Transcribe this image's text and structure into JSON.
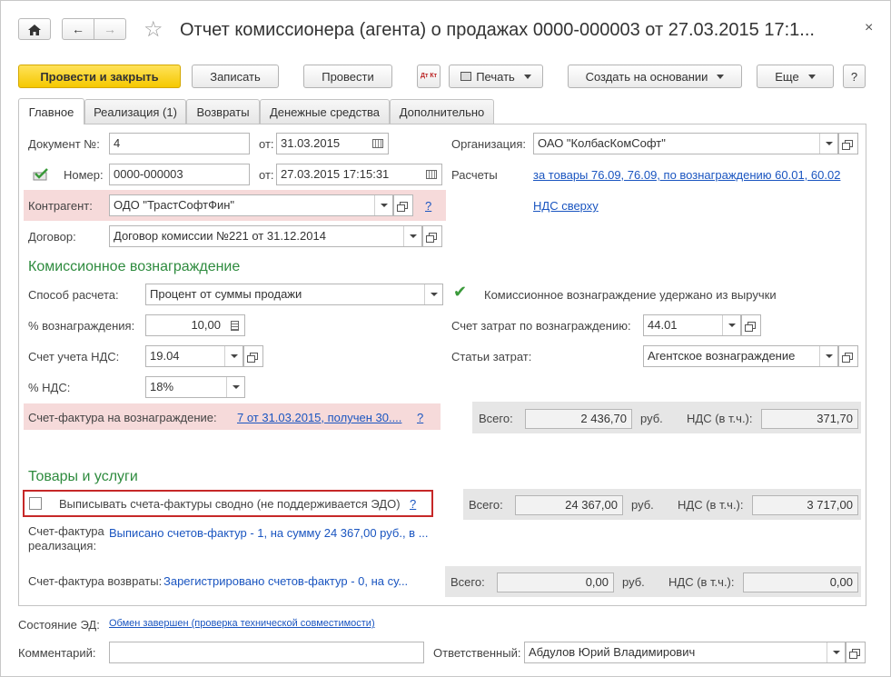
{
  "window": {
    "title": "Отчет комиссионера (агента) о продажах 0000-000003 от 27.03.2015 17:1...",
    "close": "×",
    "home": "⌂",
    "back": "←",
    "forward": "→",
    "star": "☆"
  },
  "toolbar": {
    "post_close": "Провести и закрыть",
    "save": "Записать",
    "post": "Провести",
    "dtkt": "Дт Кт",
    "print": "Печать",
    "create_based": "Создать на основании",
    "more": "Еще",
    "help": "?"
  },
  "tabs": [
    "Главное",
    "Реализация (1)",
    "Возвраты",
    "Денежные средства",
    "Дополнительно"
  ],
  "main": {
    "doc_no_label": "Документ №:",
    "doc_no": "4",
    "from_label": "от:",
    "doc_date": "31.03.2015",
    "number_label": "Номер:",
    "number": "0000-000003",
    "number_date": "27.03.2015 17:15:31",
    "org_label": "Организация:",
    "org": "ОАО \"КолбасКомСофт\"",
    "calc_label": "Расчеты",
    "calc_link": "за товары 76.09, 76.09, по вознаграждению 60.01, 60.02",
    "vat_top_link": "НДС сверху",
    "counterparty_label": "Контрагент:",
    "counterparty": "ОДО \"ТрастСофтФин\"",
    "question": "?",
    "contract_label": "Договор:",
    "contract": "Договор комиссии №221 от 31.12.2014"
  },
  "commission": {
    "section_title": "Комиссионное вознаграждение",
    "method_label": "Способ расчета:",
    "method": "Процент от суммы продажи",
    "retained_label": "Комиссионное вознаграждение удержано из выручки",
    "percent_label": "% вознаграждения:",
    "percent": "10,00",
    "cost_account_label": "Счет затрат по вознаграждению:",
    "cost_account": "44.01",
    "vat_account_label": "Счет учета НДС:",
    "vat_account": "19.04",
    "cost_items_label": "Статьи затрат:",
    "cost_items": "Агентское вознаграждение",
    "vat_rate_label": "% НДС:",
    "vat_rate": "18%",
    "invoice_label": "Счет-фактура на вознаграждение:",
    "invoice_link": "7 от 31.03.2015, получен 30....",
    "total_label": "Всего:",
    "total": "2 436,70",
    "currency": "руб.",
    "vat_incl_label": "НДС (в т.ч.):",
    "vat_incl": "371,70"
  },
  "goods": {
    "section_title": "Товары и услуги",
    "summary_invoices_label": "Выписывать счета-фактуры сводно (не поддерживается ЭДО)",
    "total_label": "Всего:",
    "total": "24 367,00",
    "currency": "руб.",
    "vat_incl_label": "НДС (в т.ч.):",
    "vat_incl": "3 717,00",
    "invoice_sale_label_1": "Счет-фактура",
    "invoice_sale_label_2": "реализация:",
    "invoice_sale_text": "Выписано счетов-фактур - 1, на сумму 24 367,00 руб., в ...",
    "invoice_returns_label": "Счет-фактура возвраты:",
    "invoice_returns_text": "Зарегистрировано счетов-фактур - 0, на су...",
    "returns_total": "0,00",
    "returns_vat": "0,00"
  },
  "footer": {
    "ed_state_label": "Состояние ЭД:",
    "ed_state_link": "Обмен завершен (проверка технической совместимости)",
    "comment_label": "Комментарий:",
    "comment": "",
    "responsible_label": "Ответственный:",
    "responsible": "Абдулов Юрий Владимирович"
  },
  "colors": {
    "accent_yellow": "#f5c800",
    "section_green": "#2e8b3e",
    "link_blue": "#1a55c0",
    "highlight_pink": "#f6dada",
    "frame_red": "#c62828"
  }
}
